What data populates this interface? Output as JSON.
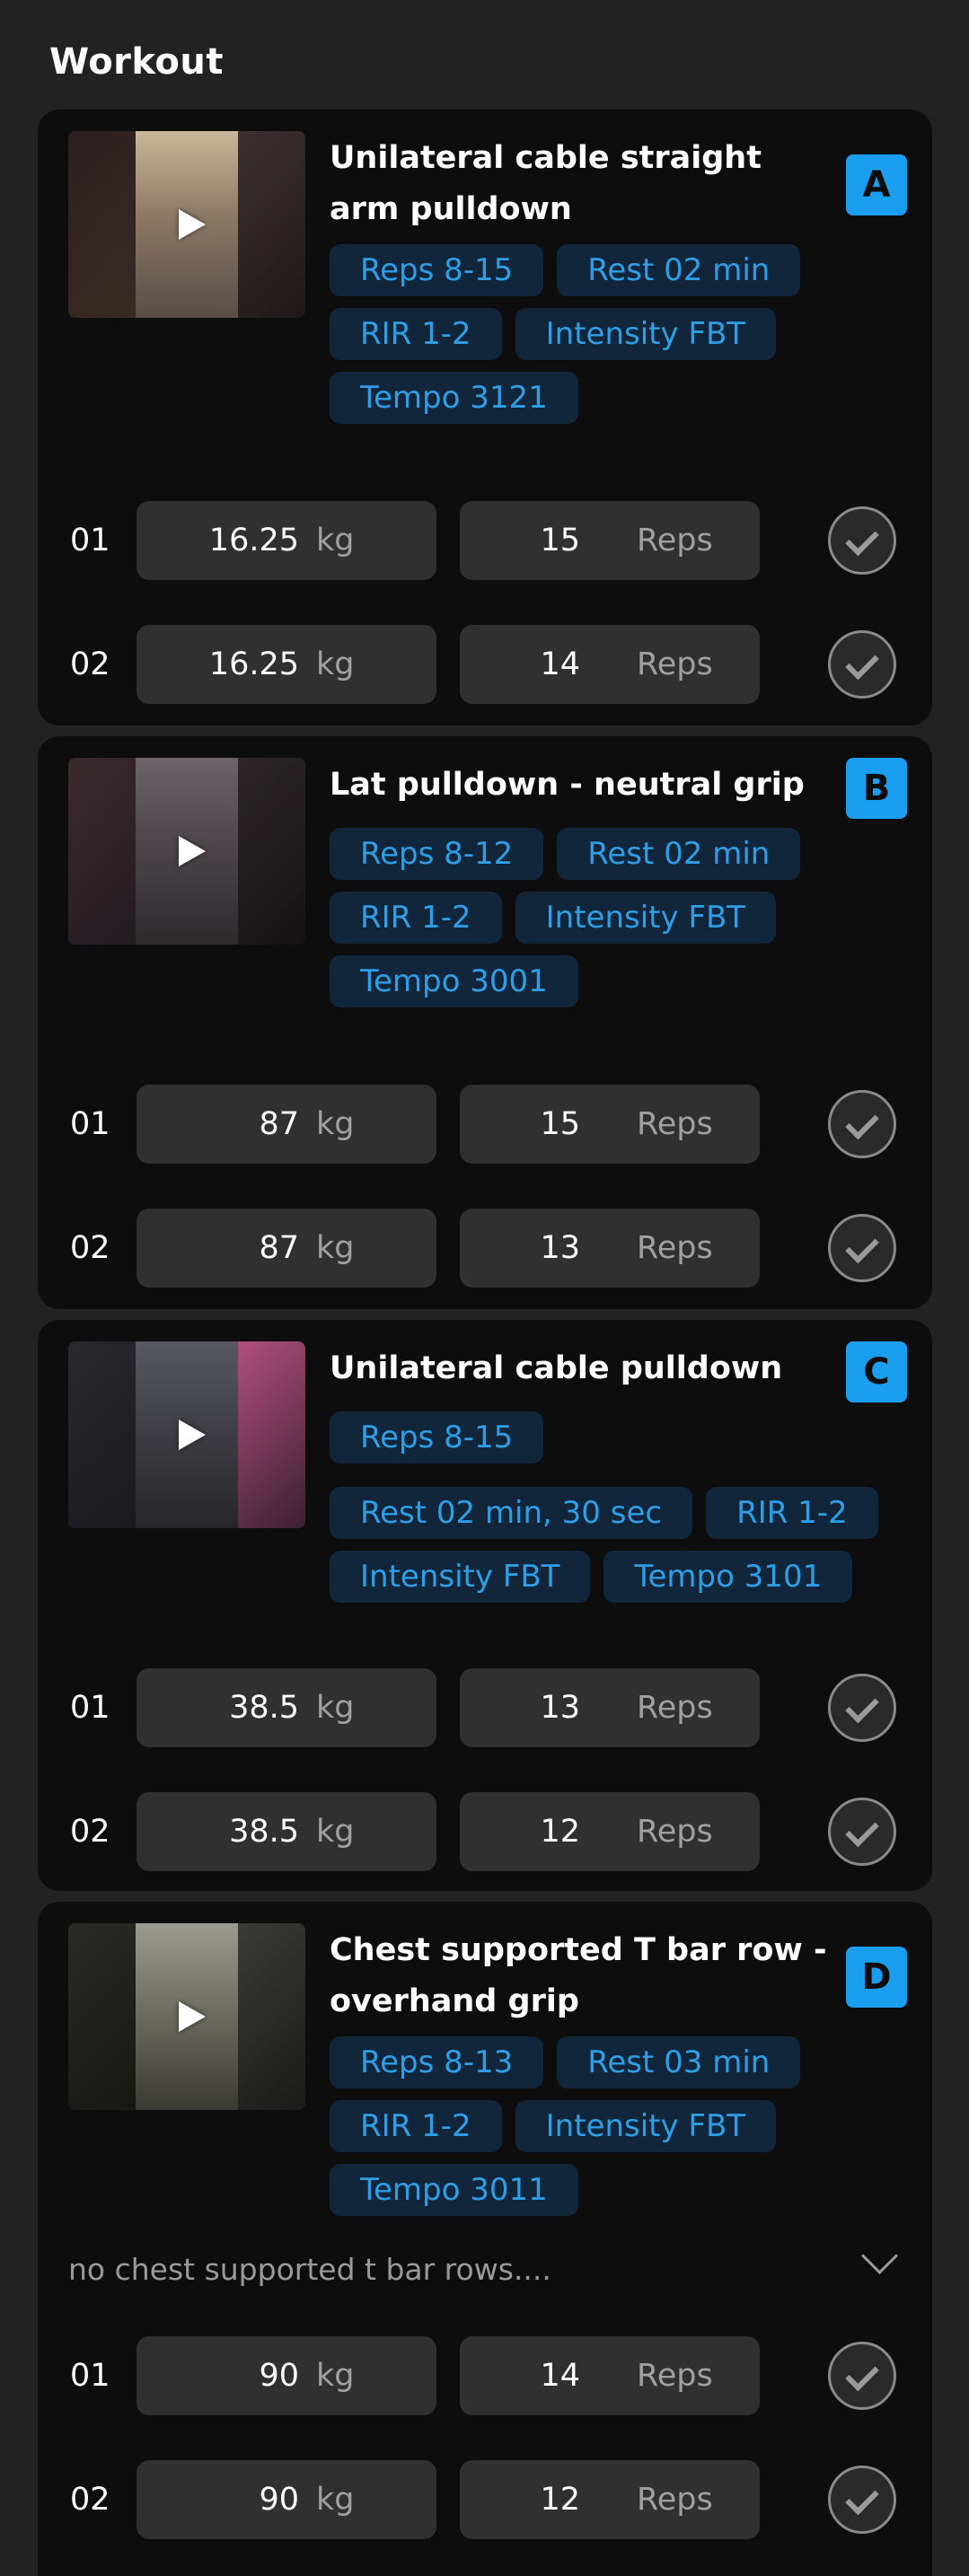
{
  "page": {
    "title": "Workout"
  },
  "colors": {
    "accent": "#1a9ef0",
    "tag_bg": "#11263a",
    "tag_text": "#2e9ee6",
    "card_bg": "#0d0d0d",
    "input_bg": "#303030"
  },
  "icons": {
    "play": "play-icon",
    "check": "check-icon",
    "chevron": "chevron-down-icon"
  },
  "exercises": [
    {
      "letter": "A",
      "title": "Unilateral cable straight arm pulldown",
      "tags": [
        "Reps 8-15",
        "Rest 02 min",
        "RIR 1-2",
        "Intensity FBT",
        "Tempo 3121"
      ],
      "sets": [
        {
          "num": "01",
          "weight": "16.25",
          "weight_unit": "kg",
          "reps": "15",
          "reps_unit": "Reps"
        },
        {
          "num": "02",
          "weight": "16.25",
          "weight_unit": "kg",
          "reps": "14",
          "reps_unit": "Reps"
        }
      ]
    },
    {
      "letter": "B",
      "title": "Lat pulldown - neutral grip",
      "tags": [
        "Reps 8-12",
        "Rest 02 min",
        "RIR 1-2",
        "Intensity FBT",
        "Tempo 3001"
      ],
      "sets": [
        {
          "num": "01",
          "weight": "87",
          "weight_unit": "kg",
          "reps": "15",
          "reps_unit": "Reps"
        },
        {
          "num": "02",
          "weight": "87",
          "weight_unit": "kg",
          "reps": "13",
          "reps_unit": "Reps"
        }
      ]
    },
    {
      "letter": "C",
      "title": "Unilateral cable pulldown",
      "tags": [
        "Reps 8-15",
        "Rest 02 min, 30 sec",
        "RIR 1-2",
        "Intensity FBT",
        "Tempo 3101"
      ],
      "sets": [
        {
          "num": "01",
          "weight": "38.5",
          "weight_unit": "kg",
          "reps": "13",
          "reps_unit": "Reps"
        },
        {
          "num": "02",
          "weight": "38.5",
          "weight_unit": "kg",
          "reps": "12",
          "reps_unit": "Reps"
        }
      ]
    },
    {
      "letter": "D",
      "title": "Chest supported T bar row - overhand grip",
      "tags": [
        "Reps 8-13",
        "Rest 03 min",
        "RIR 1-2",
        "Intensity FBT",
        "Tempo 3011"
      ],
      "note": "no chest supported t bar rows....",
      "sets": [
        {
          "num": "01",
          "weight": "90",
          "weight_unit": "kg",
          "reps": "14",
          "reps_unit": "Reps"
        },
        {
          "num": "02",
          "weight": "90",
          "weight_unit": "kg",
          "reps": "12",
          "reps_unit": "Reps"
        }
      ]
    }
  ]
}
